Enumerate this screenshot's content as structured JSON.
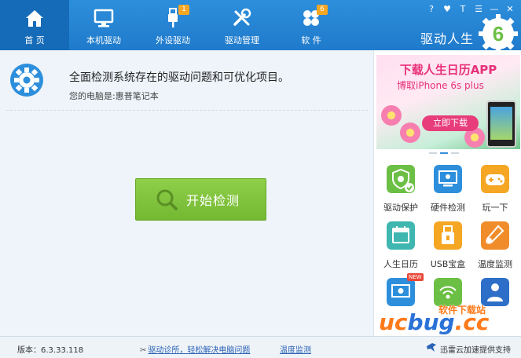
{
  "nav": {
    "items": [
      {
        "label": "首 页",
        "icon": "home-icon",
        "active": true
      },
      {
        "label": "本机驱动",
        "icon": "monitor-icon"
      },
      {
        "label": "外设驱动",
        "icon": "usb-icon",
        "badge": "1"
      },
      {
        "label": "驱动管理",
        "icon": "tools-icon"
      },
      {
        "label": "软 件",
        "icon": "clover-icon",
        "badge": "6"
      }
    ]
  },
  "window_controls": [
    "?",
    "♥",
    "T",
    "☰",
    "—",
    "✕"
  ],
  "brand": {
    "name": "驱动人生",
    "logo_digit": "6"
  },
  "main": {
    "headline": "全面检测系统存在的驱动问题和可优化项目。",
    "pc_line": "您的电脑是:惠普笔记本",
    "scan_button": "开始检测"
  },
  "banner": {
    "title": "下载人生日历APP",
    "subtitle": "博取iPhone 6s plus",
    "button": "立即下载"
  },
  "tiles": [
    {
      "label": "驱动保护",
      "icon": "driver-protect-icon",
      "color": "#6cbf45"
    },
    {
      "label": "硬件检测",
      "icon": "hardware-check-icon",
      "color": "#2d8fdc"
    },
    {
      "label": "玩一下",
      "icon": "gamepad-icon",
      "color": "#f5a623"
    },
    {
      "label": "人生日历",
      "icon": "calendar-icon",
      "color": "#3fb6b0"
    },
    {
      "label": "USB宝盒",
      "icon": "usb-box-icon",
      "color": "#f5a623"
    },
    {
      "label": "温度监测",
      "icon": "thermometer-icon",
      "color": "#f08c2a"
    },
    {
      "label": "",
      "icon": "screen-record-icon",
      "color": "#2d8fdc",
      "badge": "NEW"
    },
    {
      "label": "",
      "icon": "wifi-icon",
      "color": "#6cbf45"
    },
    {
      "label": "",
      "icon": "doctor-icon",
      "color": "#2d6fc8"
    }
  ],
  "footer": {
    "version": "版本：6.3.33.118",
    "diag_link": "驱动诊所，轻松解决电脑问题",
    "temp_link": "温度监测",
    "thunder": "迅雷云加速提供支持"
  },
  "watermark": {
    "top": "软件下载站",
    "main_a": "uc",
    "main_b": "bug",
    "main_c": ".cc"
  }
}
